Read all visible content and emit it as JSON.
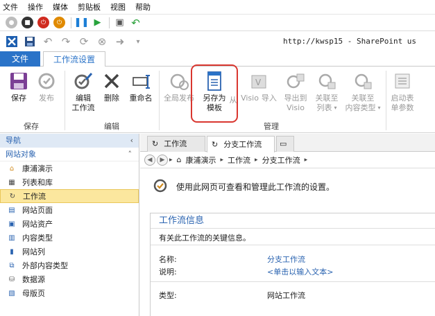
{
  "menu": [
    "文件",
    "操作",
    "媒体",
    "剪贴板",
    "视图",
    "帮助"
  ],
  "address": "http://kwsp15 - SharePoint us",
  "tabs": {
    "file": "文件",
    "workflow_settings": "工作流设置"
  },
  "ribbon": {
    "save": "保存",
    "publish": "发布",
    "edit_line1": "编辑",
    "edit_line2": "工作流",
    "delete": "删除",
    "rename": "重命名",
    "global_publish": "全局发布",
    "save_template_line1": "另存为",
    "save_template_line2": "模板",
    "from_visio_prefix": "从",
    "from_visio_line1": "Visio",
    "from_visio_line2": "导入",
    "export_visio_line1": "导出到",
    "export_visio_line2": "Visio",
    "assoc_list_line1": "关联至",
    "assoc_list_line2": "列表",
    "assoc_ct_line1": "关联至",
    "assoc_ct_line2": "内容类型",
    "start_form_line1": "启动表",
    "start_form_line2": "单参数",
    "group_save": "保存",
    "group_edit": "编辑",
    "group_manage": "管理"
  },
  "nav": {
    "header": "导航",
    "section": "网站对象",
    "items": [
      {
        "label": "康浦演示",
        "icon": "home-icon"
      },
      {
        "label": "列表和库",
        "icon": "list-icon"
      },
      {
        "label": "工作流",
        "icon": "workflow-icon"
      },
      {
        "label": "网站页面",
        "icon": "page-icon"
      },
      {
        "label": "网站资产",
        "icon": "assets-icon"
      },
      {
        "label": "内容类型",
        "icon": "content-type-icon"
      },
      {
        "label": "网站列",
        "icon": "column-icon"
      },
      {
        "label": "外部内容类型",
        "icon": "external-icon"
      },
      {
        "label": "数据源",
        "icon": "database-icon"
      },
      {
        "label": "母版页",
        "icon": "master-page-icon"
      }
    ]
  },
  "doc_tabs": [
    "工作流",
    "分支工作流"
  ],
  "breadcrumb": [
    "康浦演示",
    "工作流",
    "分支工作流"
  ],
  "intro_text": "使用此网页可查看和管理此工作流的设置。",
  "info": {
    "title": "工作流信息",
    "desc": "有关此工作流的关键信息。",
    "name_label": "名称:",
    "name_value": "分支工作流",
    "desc_label": "说明:",
    "desc_value": "<单击以输入文本>",
    "type_label": "类型:",
    "type_value": "网站工作流"
  },
  "colors": {
    "accent": "#2a73c8",
    "selected": "#fbe79e",
    "highlight": "#d9362f"
  }
}
